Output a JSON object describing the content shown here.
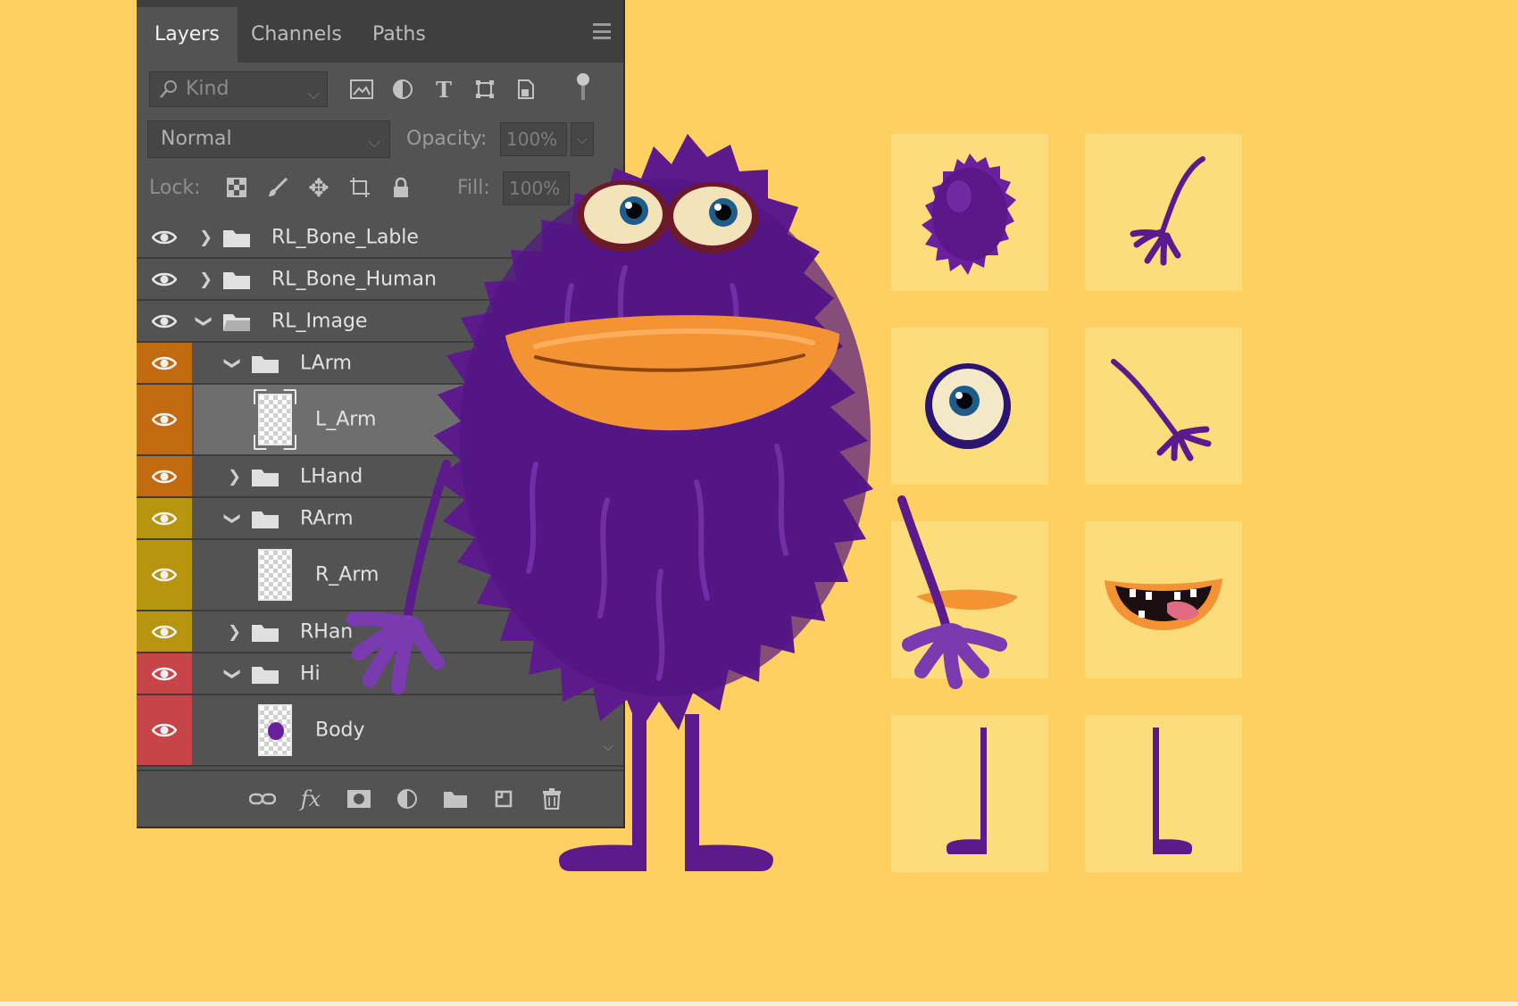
{
  "colors": {
    "background": "#fed061",
    "panel": "#535353",
    "tabbar": "#3f3f3f",
    "tag_orange": "#c26a0e",
    "tag_yellow": "#b7950f",
    "tag_red": "#c74548",
    "character_purple": "#5c1a8d",
    "mouth_orange": "#f49334"
  },
  "panel": {
    "tabs": [
      {
        "label": "Layers",
        "active": true
      },
      {
        "label": "Channels",
        "active": false
      },
      {
        "label": "Paths",
        "active": false
      }
    ],
    "filter": {
      "placeholder": "Kind",
      "icons": [
        "image-filter-icon",
        "adjustment-filter-icon",
        "type-filter-icon",
        "shape-filter-icon",
        "smart-object-filter-icon"
      ]
    },
    "blend_mode": "Normal",
    "opacity_label": "Opacity:",
    "opacity_value": "100%",
    "lock_label": "Lock:",
    "fill_label": "Fill:",
    "fill_value": "100%",
    "layers": [
      {
        "name": "RL_Bone_Lable",
        "type": "group",
        "expanded": false,
        "depth": 0,
        "tag": null
      },
      {
        "name": "RL_Bone_Human",
        "type": "group",
        "expanded": false,
        "depth": 0,
        "tag": null
      },
      {
        "name": "RL_Image",
        "type": "group",
        "expanded": true,
        "depth": 0,
        "tag": null
      },
      {
        "name": "LArm",
        "type": "group",
        "expanded": true,
        "depth": 1,
        "tag": "orange"
      },
      {
        "name": "L_Arm",
        "type": "layer",
        "depth": 2,
        "tag": "orange",
        "selected": true
      },
      {
        "name": "LHand",
        "type": "group",
        "expanded": false,
        "depth": 1,
        "tag": "orange"
      },
      {
        "name": "RArm",
        "type": "group",
        "expanded": true,
        "depth": 1,
        "tag": "yellow"
      },
      {
        "name": "R_Arm",
        "type": "layer",
        "depth": 2,
        "tag": "yellow"
      },
      {
        "name": "RHan",
        "type": "group",
        "expanded": false,
        "depth": 1,
        "tag": "yellow"
      },
      {
        "name": "Hi",
        "type": "group",
        "expanded": true,
        "depth": 1,
        "tag": "red"
      },
      {
        "name": "Body",
        "type": "layer",
        "depth": 2,
        "tag": "red",
        "thumb": "body"
      }
    ],
    "footer_icons": [
      "link-layers-icon",
      "fx-icon",
      "add-mask-icon",
      "adjustment-layer-icon",
      "new-group-icon",
      "new-layer-icon",
      "delete-layer-icon"
    ],
    "footer_fx": "fx"
  },
  "parts": [
    "body-fur",
    "left-arm",
    "eye",
    "right-arm",
    "mouth-closed",
    "mouth-open",
    "left-leg",
    "right-leg"
  ]
}
